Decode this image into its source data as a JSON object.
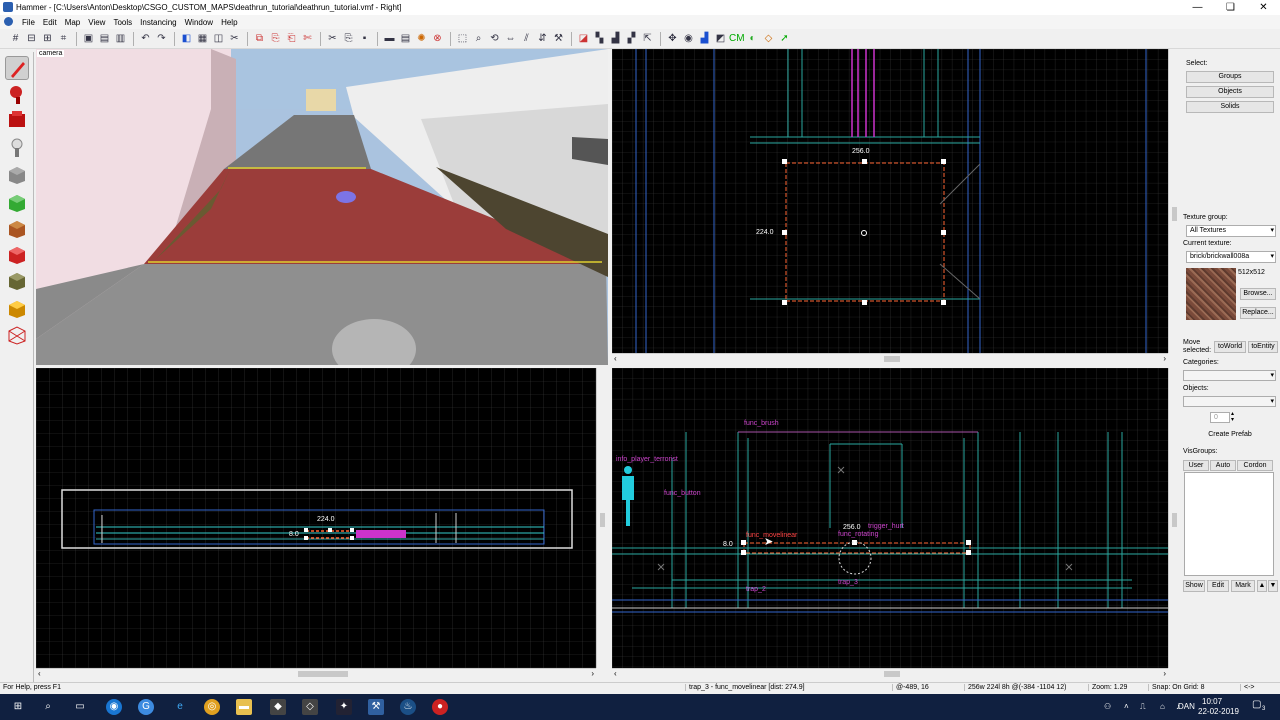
{
  "window": {
    "title": "Hammer - [C:\\Users\\Anton\\Desktop\\CSGO_CUSTOM_MAPS\\deathrun_tutorial\\deathrun_tutorial.vmf - Right]",
    "minimize": "—",
    "restore": "❏",
    "close": "✕"
  },
  "menu": [
    "File",
    "Edit",
    "Map",
    "View",
    "Tools",
    "Instancing",
    "Window",
    "Help"
  ],
  "viewports": {
    "camera_label": "camera",
    "top": {
      "width_label": "256.0",
      "height_label": "224.0"
    },
    "front": {
      "width_label": "224.0",
      "depth_label": "8.0"
    },
    "side": {
      "width_label": "256.0",
      "depth_label": "8.0",
      "entity_labels": [
        "func_brush",
        "info_player_terrorist",
        "func_button",
        "func_movelinear",
        "trigger_hurt",
        "func_rotating",
        "trap_3",
        "trap_2"
      ]
    }
  },
  "right_panel": {
    "select_label": "Select:",
    "select_buttons": [
      "Groups",
      "Objects",
      "Solids"
    ],
    "texture_group_label": "Texture group:",
    "texture_group_value": "All Textures",
    "current_texture_label": "Current texture:",
    "current_texture_value": "brick/brickwall008a",
    "texture_size": "512x512",
    "browse": "Browse...",
    "replace": "Replace...",
    "move_selected_label": "Move\nselected:",
    "to_world": "toWorld",
    "to_entity": "toEntity",
    "categories_label": "Categories:",
    "objects_label": "Objects:",
    "objects_count": "0",
    "create_prefab": "Create Prefab",
    "visgroups_label": "VisGroups:",
    "visgroup_tabs": [
      "User",
      "Auto",
      "Cordon"
    ],
    "bottom_buttons": [
      "Show",
      "Edit",
      "Mark"
    ]
  },
  "status": {
    "help": "For Help, press F1",
    "selection": "trap_3 - func_movelinear  [dist: 274.9]",
    "coords": "@-489, 16",
    "size": "256w 224l 8h @(-384 -1104 12)",
    "zoom": "Zoom: 1.29",
    "snap": "Snap: On Grid: 8",
    "arrow": "<->"
  },
  "taskbar": {
    "time": "10:07",
    "date": "22-02-2019",
    "lang": "DAN",
    "notif": "3"
  },
  "colors": {
    "grid": "#3a3a3a",
    "selection": "#ff6633",
    "entity": "#cc44cc",
    "brush_cyan": "#33cccc",
    "brush_blue": "#3366cc"
  }
}
